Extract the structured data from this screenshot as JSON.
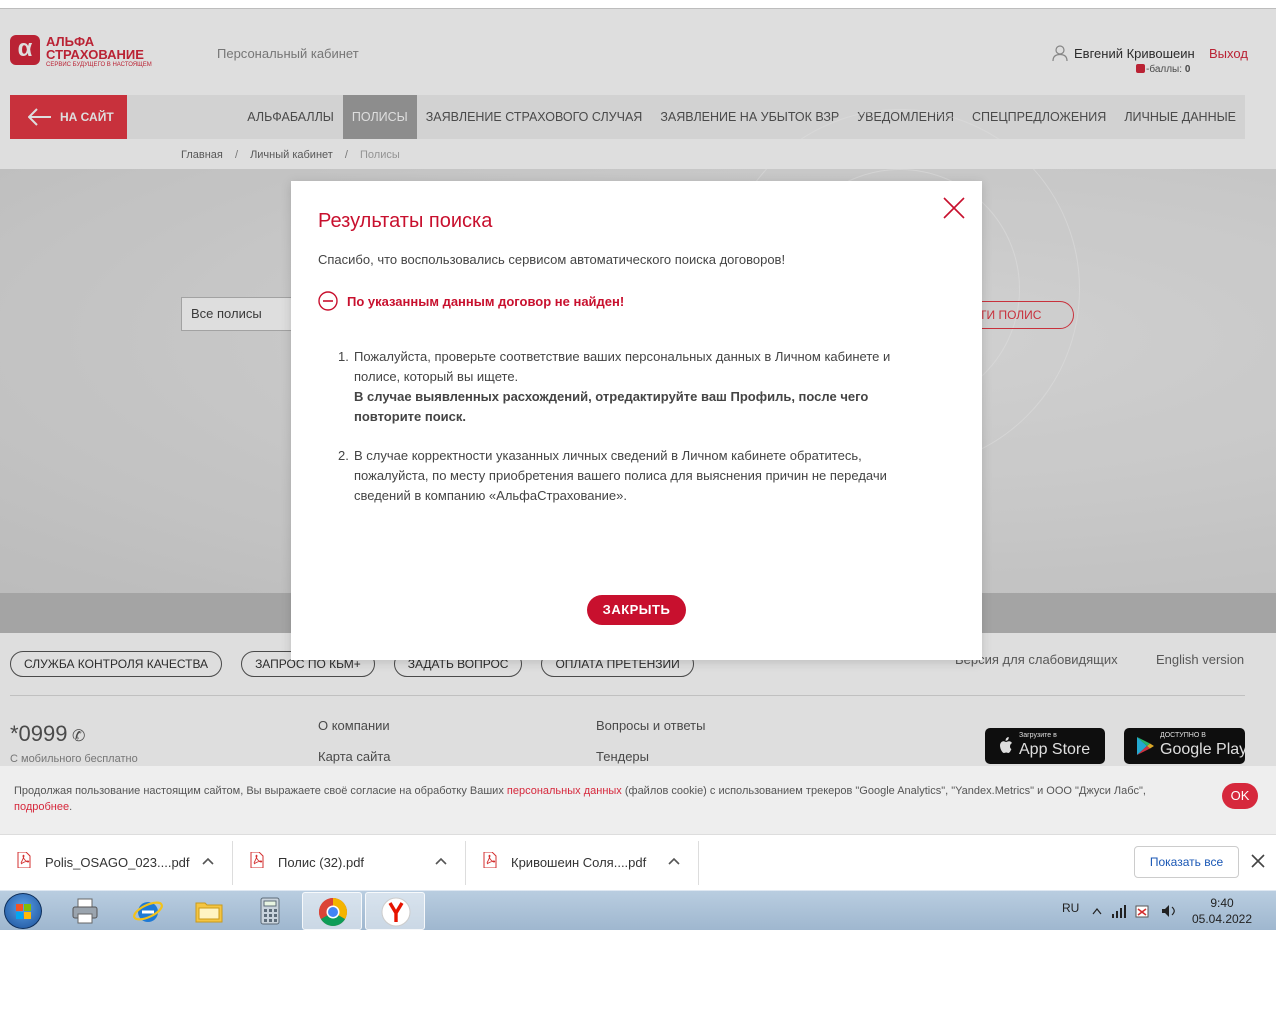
{
  "brand": {
    "logo_mark": "α",
    "logo_line1": "АЛЬФА",
    "logo_line2": "СТРАХОВАНИЕ",
    "slogan": "СЕРВИС БУДУЩЕГО В НАСТОЯЩЕМ",
    "accent_color": "#d6283c"
  },
  "header": {
    "cabinet_title": "Персональный кабинет",
    "user_name": "Евгений Кривошеин",
    "points_label": "-баллы:",
    "points_value": "0",
    "logout_label": "Выход"
  },
  "navbar": {
    "back_label": "НА САЙТ",
    "items": [
      {
        "label": "АЛЬФАБАЛЛЫ",
        "active": false
      },
      {
        "label": "ПОЛИСЫ",
        "active": true
      },
      {
        "label": "ЗАЯВЛЕНИЕ СТРАХОВОГО СЛУЧАЯ",
        "active": false
      },
      {
        "label": "ЗАЯВЛЕНИЕ НА УБЫТОК ВЗР",
        "active": false
      },
      {
        "label": "УВЕДОМЛЕНИЯ",
        "active": false
      },
      {
        "label": "СПЕЦПРЕДЛОЖЕНИЯ",
        "active": false
      },
      {
        "label": "ЛИЧНЫЕ ДАННЫЕ",
        "active": false
      }
    ]
  },
  "breadcrumb": {
    "home": "Главная",
    "separator": "/",
    "cabinet": "Личный кабинет",
    "current": "Полисы"
  },
  "search": {
    "policy_select_value": "Все полисы",
    "find_button_label": "АЙТИ ПОЛИС"
  },
  "modal": {
    "title": "Результаты поиска",
    "thanks": "Спасибо, что воспользовались сервисом автоматического поиска договоров!",
    "not_found": "По указанным данным договор не найден!",
    "step1_num": "1.",
    "step1_text": "Пожалуйста, проверьте соответствие ваших персональных данных в Личном кабинете и  полисе, который вы ищете.",
    "step1_bold": "В случае выявленных расхождений, отредактируйте ваш Профиль, после чего повторите поиск",
    "step1_dot": ".",
    "step2_num": "2.",
    "step2_text": "В случае корректности указанных личных сведений в Личном кабинете обратитесь, пожалуйста, по месту приобретения вашего полиса для выяснения причин не передачи сведений в компанию «АльфаСтрахование».",
    "close_button": "ЗАКРЫТЬ"
  },
  "footer": {
    "pills": [
      "СЛУЖБА КОНТРОЛЯ КАЧЕСТВА",
      "ЗАПРОС ПО КЬМ+",
      "ЗАДАТЬ ВОПРОС",
      "ОПЛАТА ПРЕТЕНЗИИ"
    ],
    "accessibility": "Версия для слабовидящих",
    "english": "English version",
    "phone": "*0999",
    "phone_sub": "С мобильного бесплатно",
    "links": {
      "about": "О компании",
      "sitemap": "Карта сайта",
      "faq": "Вопросы и ответы",
      "tenders": "Тендеры"
    },
    "appstore_small": "Загрузите в",
    "appstore_big": "App Store",
    "gplay_small": "ДОСТУПНО В",
    "gplay_big": "Google Play"
  },
  "cookie": {
    "text_before": "Продолжая пользование настоящим сайтом, Вы выражаете своё согласие на обработку Ваших ",
    "link1": "персональных данных",
    "text_middle": " (файлов cookie) с использованием трекеров \"Google Analytics\",  \"Yandex.Metrics\" и ООО \"Джуси Лабс\", ",
    "link2": "подробнее",
    "text_after": ".",
    "ok_label": "OK"
  },
  "downloads": {
    "files": [
      "Polis_OSAGO_023....pdf",
      "Полис (32).pdf",
      "Кривошеин Соля....pdf"
    ],
    "show_all": "Показать все"
  },
  "taskbar": {
    "apps": [
      "printer",
      "internet-explorer",
      "file-explorer",
      "calculator",
      "chrome",
      "yandex-browser"
    ],
    "active_app": "chrome",
    "lang": "RU",
    "time": "9:40",
    "date": "05.04.2022"
  }
}
